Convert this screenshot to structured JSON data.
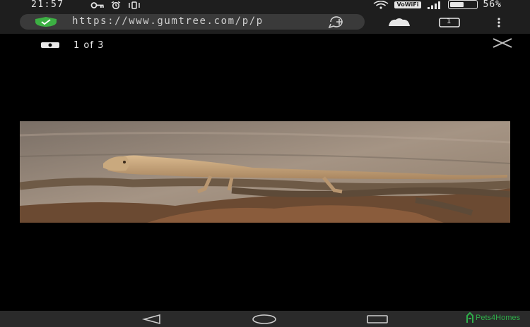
{
  "status_bar": {
    "time": "21:57",
    "network_badge": "VoWiFi",
    "battery_percent": "56%",
    "battery_level": 0.56
  },
  "browser": {
    "url": "https://www.gumtree.com/p/p",
    "tab_count": "1"
  },
  "viewer": {
    "counter": "1 of 3"
  },
  "watermark": {
    "text": "Pets4Homes"
  },
  "colors": {
    "shield_green": "#3cb043",
    "watermark_green": "#2fae4a"
  }
}
